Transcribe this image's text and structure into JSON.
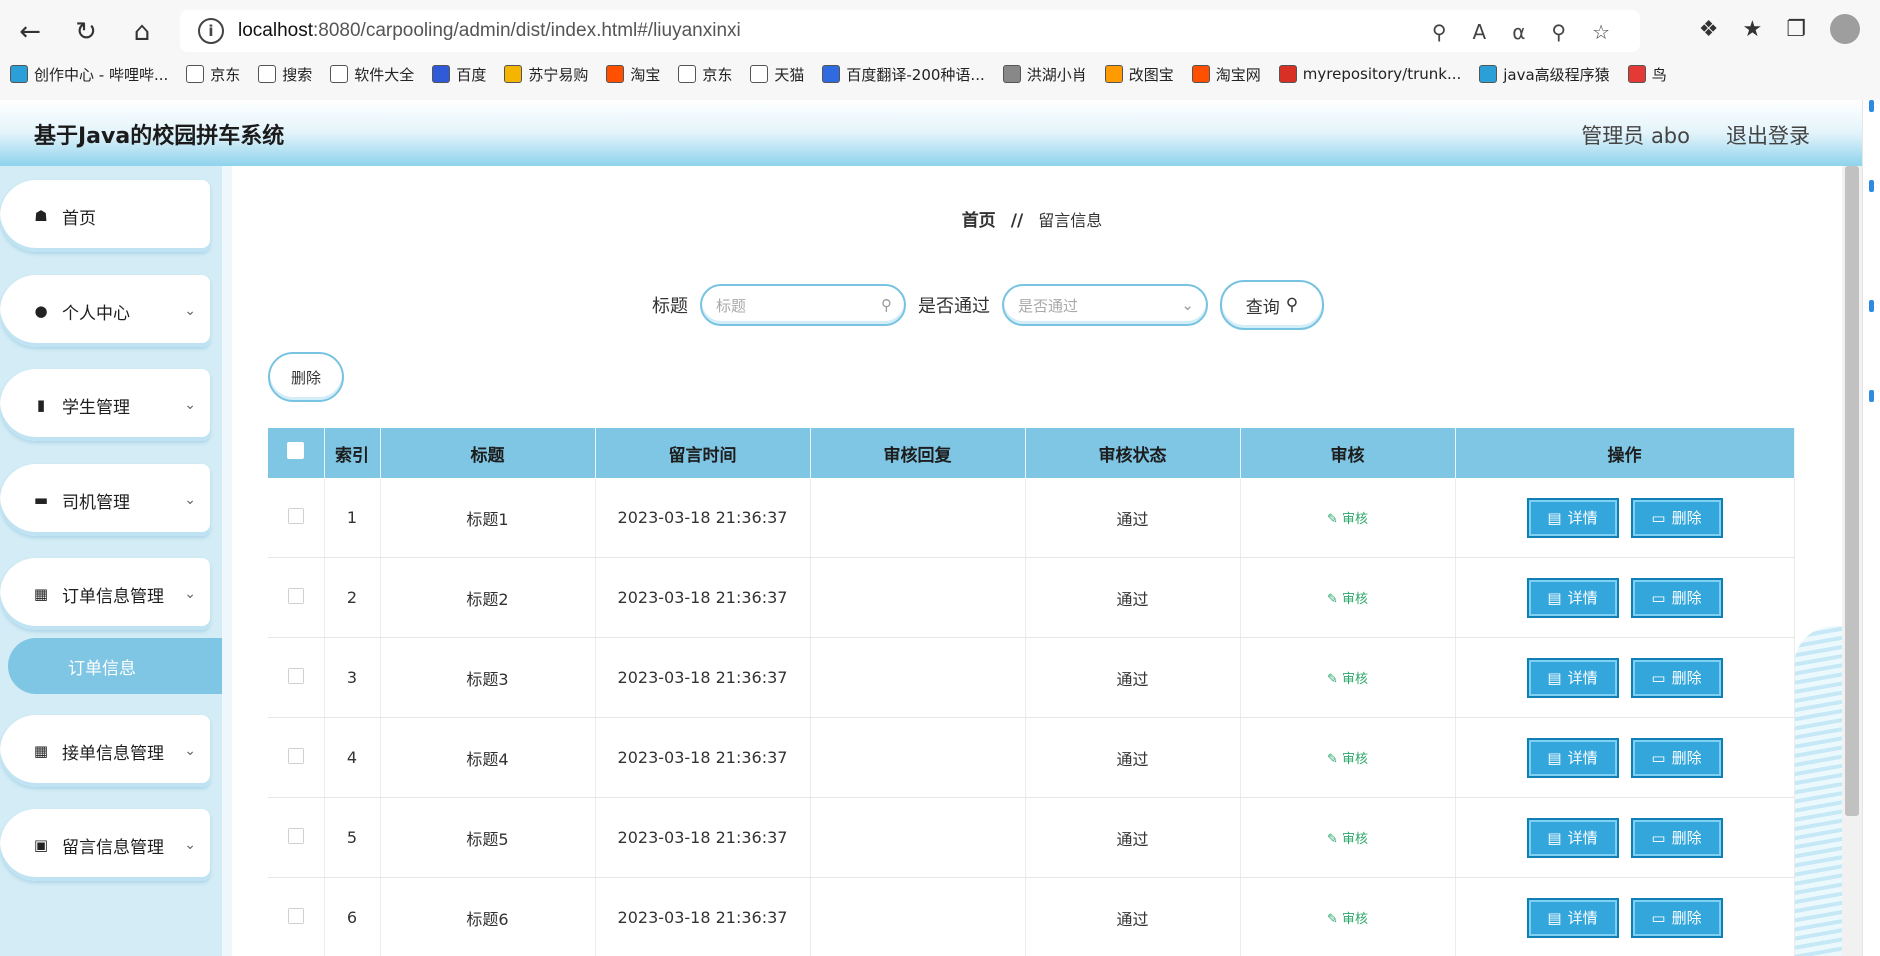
{
  "browser": {
    "url_host": "localhost",
    "url_rest": ":8080/carpooling/admin/dist/index.html#/liuyanxinxi",
    "bookmarks": [
      {
        "label": "创作中心 - 哔哩哔...",
        "color": "#2b9fd8"
      },
      {
        "label": "京东",
        "color": "#ffffff"
      },
      {
        "label": "搜索",
        "color": "#ffffff"
      },
      {
        "label": "软件大全",
        "color": "#ffffff"
      },
      {
        "label": "百度",
        "color": "#2f5bd8"
      },
      {
        "label": "苏宁易购",
        "color": "#f4b400"
      },
      {
        "label": "淘宝",
        "color": "#ff5000"
      },
      {
        "label": "京东",
        "color": "#ffffff"
      },
      {
        "label": "天猫",
        "color": "#ffffff"
      },
      {
        "label": "百度翻译-200种语...",
        "color": "#2f6ae0"
      },
      {
        "label": "洪湖小肖",
        "color": "#888888"
      },
      {
        "label": "改图宝",
        "color": "#ff9a00"
      },
      {
        "label": "淘宝网",
        "color": "#ff5000"
      },
      {
        "label": "myrepository/trunk...",
        "color": "#d93025"
      },
      {
        "label": "java高级程序猿",
        "color": "#2b9fd8"
      },
      {
        "label": "鸟",
        "color": "#e53935"
      }
    ]
  },
  "header": {
    "title": "基于Java的校园拼车系统",
    "admin": "管理员 abo",
    "logout": "退出登录"
  },
  "sidebar": {
    "items": [
      {
        "label": "首页",
        "icon": "home-icon"
      },
      {
        "label": "个人中心",
        "icon": "user-icon"
      },
      {
        "label": "学生管理",
        "icon": "bar-chart-icon"
      },
      {
        "label": "司机管理",
        "icon": "ticket-icon"
      },
      {
        "label": "订单信息管理",
        "icon": "grid-icon"
      },
      {
        "label": "接单信息管理",
        "icon": "grid-icon"
      },
      {
        "label": "留言信息管理",
        "icon": "wallet-icon"
      }
    ],
    "submenu_label": "订单信息"
  },
  "breadcrumb": {
    "home": "首页",
    "sep": "//",
    "current": "留言信息"
  },
  "search": {
    "title_label": "标题",
    "title_placeholder": "标题",
    "pass_label": "是否通过",
    "pass_placeholder": "是否通过",
    "query_label": "查询"
  },
  "batch_delete": "删除",
  "table": {
    "headers": [
      "索引",
      "标题",
      "留言时间",
      "审核回复",
      "审核状态",
      "审核",
      "操作"
    ],
    "audit_label": "审核",
    "detail_label": "详情",
    "delete_label": "删除",
    "rows": [
      {
        "index": "1",
        "title": "标题1",
        "time": "2023-03-18 21:36:37",
        "reply": "",
        "status": "通过"
      },
      {
        "index": "2",
        "title": "标题2",
        "time": "2023-03-18 21:36:37",
        "reply": "",
        "status": "通过"
      },
      {
        "index": "3",
        "title": "标题3",
        "time": "2023-03-18 21:36:37",
        "reply": "",
        "status": "通过"
      },
      {
        "index": "4",
        "title": "标题4",
        "time": "2023-03-18 21:36:37",
        "reply": "",
        "status": "通过"
      },
      {
        "index": "5",
        "title": "标题5",
        "time": "2023-03-18 21:36:37",
        "reply": "",
        "status": "通过"
      },
      {
        "index": "6",
        "title": "标题6",
        "time": "2023-03-18 21:36:37",
        "reply": "",
        "status": "通过"
      }
    ]
  },
  "colors": {
    "accent": "#7ec6e4",
    "button": "#33a6dc",
    "audit": "#2fa86d"
  }
}
